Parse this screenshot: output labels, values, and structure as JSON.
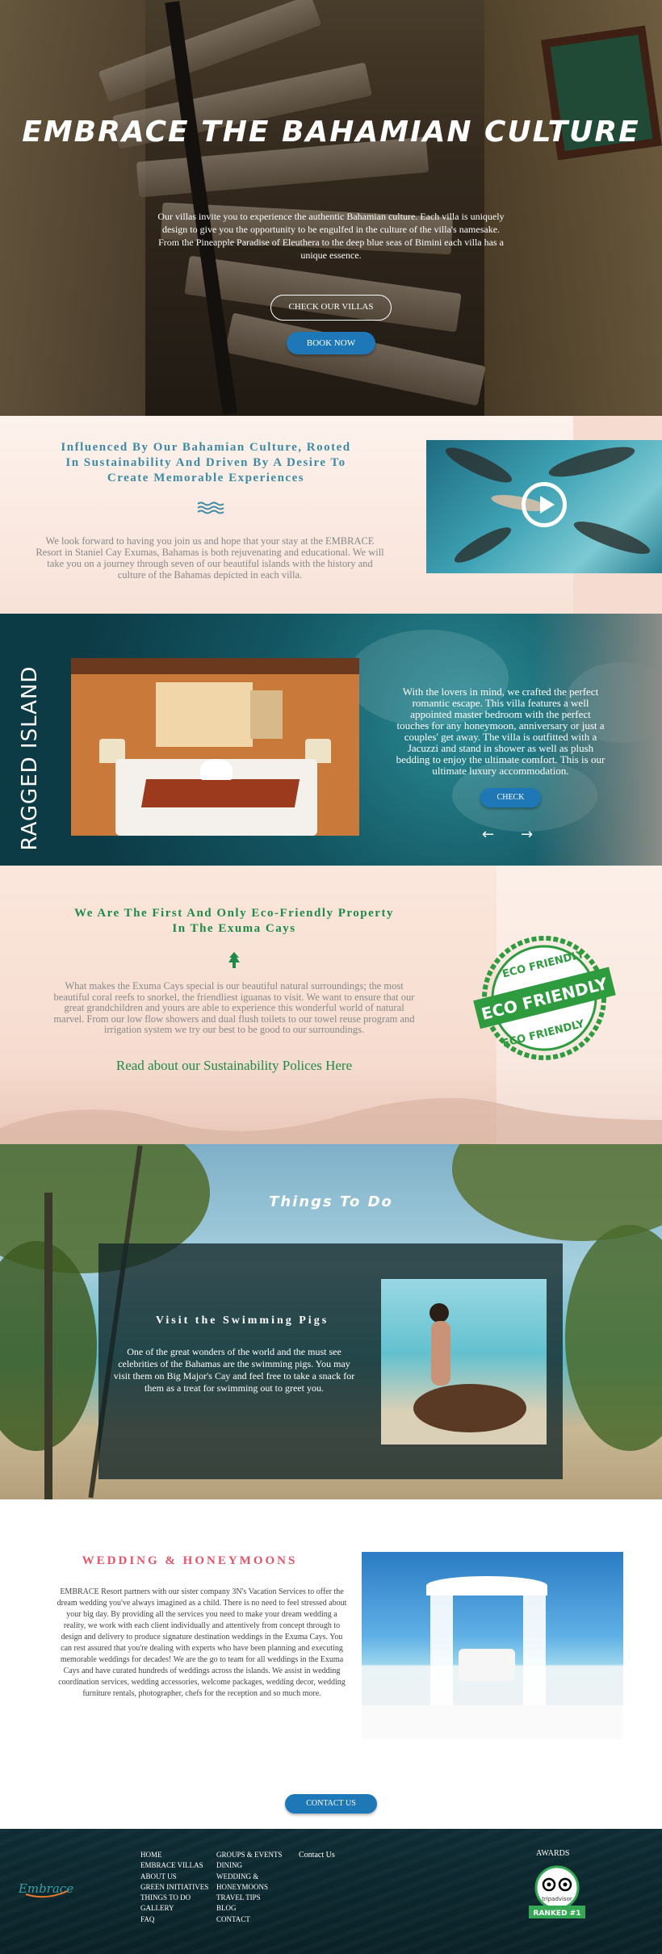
{
  "hero": {
    "title": "EMBRACE THE BAHAMIAN CULTURE",
    "text": "Our villas invite you to experience the authentic Bahamian culture. Each villa is uniquely design to give you the opportunity to be engulfed in the culture of the villa's namesake. From the Pineapple Paradise of Eleuthera to the deep blue seas of Bimini each villa has a unique essence.",
    "check_villas_label": "CHECK OUR VILLAS",
    "book_now_label": "BOOK NOW"
  },
  "influenced": {
    "title": "Influenced By Our Bahamian Culture, Rooted In Sustainability And Driven By A Desire To Create Memorable Experiences",
    "text": "We look forward to having you join us and hope that your stay at the EMBRACE Resort in Staniel Cay Exumas, Bahamas is both rejuvenating and educational. We will take you on a journey through seven of our beautiful islands with the history and culture of the Bahamas depicted in each villa.",
    "icon": "waves-icon",
    "video_icon": "play-icon"
  },
  "villa": {
    "name": "RAGGED ISLAND",
    "text": "With the lovers in mind, we crafted the perfect romantic escape. This villa features a well appointed master bedroom with the perfect touches for any honeymoon, anniversary or just a couples' get away. The villa is outfitted with a Jacuzzi and stand in shower as well as plush bedding to enjoy the ultimate comfort. This is our ultimate luxury accommodation.",
    "check_label": "CHECK",
    "prev_label": "←",
    "next_label": "→"
  },
  "eco": {
    "title": "We Are The First And Only Eco-Friendly Property In The Exuma Cays",
    "text": "What makes the Exuma Cays special is our beautiful natural surroundings; the most beautiful coral reefs to snorkel, the friendliest iguanas to visit. We want to ensure that our great grandchildren and yours are able to experience this wonderful world of natural marvel. From our low flow showers and dual flush toilets to our towel reuse program and irrigation system we try our best to be good to our surroundings.",
    "link": "Read about our Sustainability Polices Here",
    "badge_top": "ECO FRIENDLY",
    "badge_mid": "ECO FRIENDLY",
    "badge_bottom": "ECO FRIENDLY",
    "color": "#1e8a48"
  },
  "things": {
    "title": "Things To Do",
    "activity_title": "Visit the Swimming Pigs",
    "activity_text": "One of the great wonders of the world and the must see celebrities of the Bahamas are the swimming pigs. You may visit them on Big Major's Cay and feel free to take a snack for them as a treat for swimming out to greet you."
  },
  "wedding": {
    "title": "WEDDING & HONEYMOONS",
    "text": "EMBRACE Resort partners with our sister company 3N's Vacation Services to offer the dream wedding you've always imagined as a child. There is no need to feel stressed about your big day. By providing all the services you need to make your dream wedding a reality, we work with each client individually and attentively from concept through to design and delivery to produce signature destination weddings in the Exuma Cays. You can rest assured that you're dealing with experts who have been planning and executing memorable weddings for decades! We are the go to team for all weddings in the Exuma Cays and have curated hundreds of weddings across the islands. We assist in wedding coordination services, wedding accessories, welcome packages, wedding decor, wedding furniture rentals, photographer, chefs for the reception and so much more.",
    "contact_label": "CONTACT US"
  },
  "footer": {
    "logo": "Embrace",
    "col1": [
      "HOME",
      "EMBRACE VILLAS",
      "ABOUT US",
      "GREEN INITIATIVES",
      "THINGS TO DO",
      "GALLERY",
      "FAQ"
    ],
    "col2": [
      "GROUPS & EVENTS",
      "DINING",
      "WEDDING &",
      "HONEYMOONS",
      "TRAVEL TIPS",
      "BLOG",
      "CONTACT"
    ],
    "contact_label": "Contact Us",
    "awards_label": "AWARDS",
    "tripadvisor_label": "tripadvisor",
    "ranked_label": "RANKED #1"
  },
  "colors": {
    "accent_blue": "#1e78b8",
    "teal_title": "#3c8aa3",
    "wedding_pink": "#e4536a",
    "footer_bg": "#0f2c34"
  }
}
